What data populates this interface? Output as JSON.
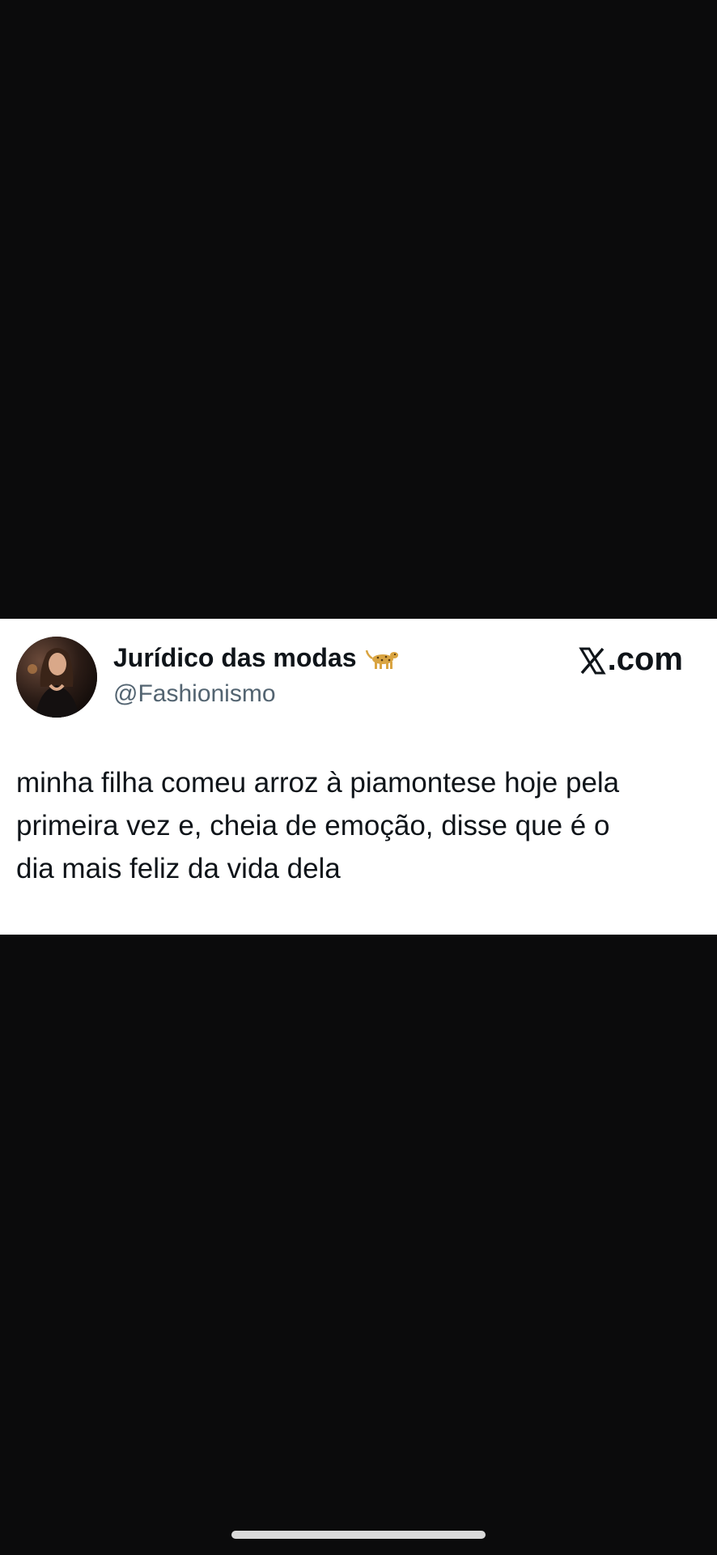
{
  "tweet": {
    "display_name": "Jurídico das modas",
    "name_emoji_icon": "leopard-icon",
    "handle": "@Fashionismo",
    "brand_label": ".com",
    "brand_icon": "x-logo-icon",
    "text_lines": [
      "minha filha comeu arroz à piamontese hoje pela",
      "primeira vez e, cheia de emoção, disse que é o",
      "dia mais feliz da vida dela"
    ]
  },
  "colors": {
    "background": "#0b0b0c",
    "card": "#ffffff",
    "text_primary": "#0f1419",
    "text_secondary": "#536471",
    "home_indicator": "#d9d9d9"
  }
}
